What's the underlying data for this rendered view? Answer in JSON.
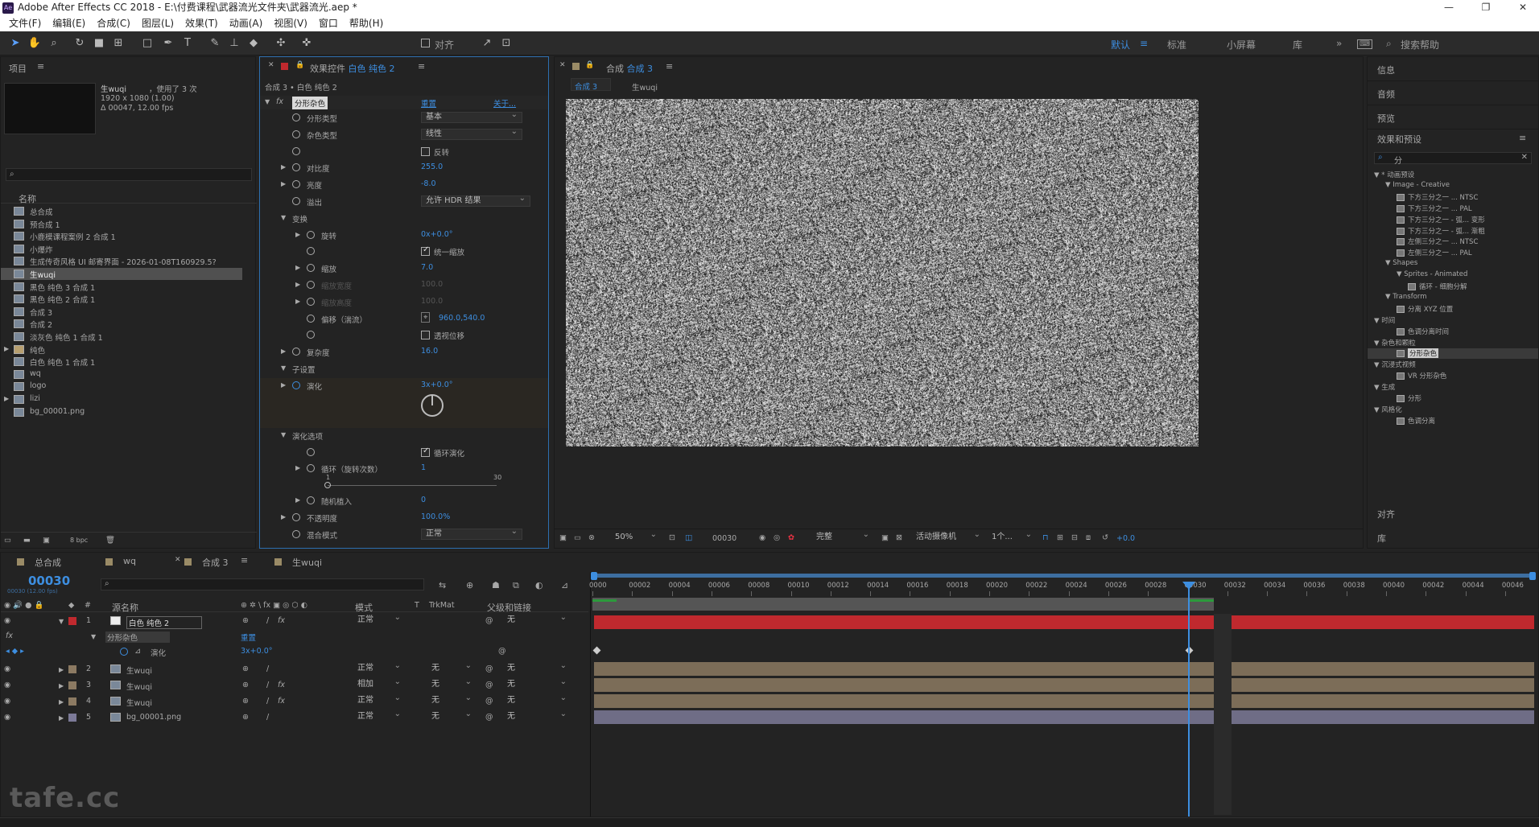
{
  "app": {
    "title": "Adobe After Effects CC 2018 - E:\\付费课程\\武器流光文件夹\\武器流光.aep *",
    "logo": "Ae"
  },
  "menu": [
    "文件(F)",
    "编辑(E)",
    "合成(C)",
    "图层(L)",
    "效果(T)",
    "动画(A)",
    "视图(V)",
    "窗口",
    "帮助(H)"
  ],
  "toolbar": {
    "align_label": "对齐",
    "workspaces": [
      "默认",
      "标准",
      "小屏幕",
      "库"
    ],
    "search_placeholder": "搜索帮助"
  },
  "project": {
    "title": "项目",
    "item_name": "生wuqi",
    "item_info": "，使用了 3 次",
    "item_size": "1920 x 1080 (1.00)",
    "item_dur": "Δ 00047, 12.00 fps",
    "col_name": "名称",
    "bpc": "8 bpc",
    "items": [
      "总合成",
      "预合成 1",
      "小鹿模课程案例 2 合成 1",
      "小爆炸",
      "生成传奇风格 UI 邮寄界面 - 2026-01-08T160929.5?",
      "生wuqi",
      "黑色 纯色 3 合成 1",
      "黑色 纯色 2 合成 1",
      "合成 3",
      "合成 2",
      "淡灰色 纯色 1 合成 1",
      "纯色",
      "白色 纯色 1 合成 1",
      "wq",
      "logo",
      "lizi",
      "bg_00001.png"
    ]
  },
  "effects": {
    "title": "效果控件",
    "layer": "白色 纯色 2",
    "breadcrumb": "合成 3 • 白色 纯色 2",
    "effect_name": "分形杂色",
    "reset": "重置",
    "about": "关于...",
    "props": [
      {
        "label": "分形类型",
        "value": "基本",
        "kind": "dd"
      },
      {
        "label": "杂色类型",
        "value": "线性",
        "kind": "dd"
      },
      {
        "label": "",
        "value": "反转",
        "kind": "cb"
      },
      {
        "label": "对比度",
        "value": "255.0",
        "kind": "num"
      },
      {
        "label": "亮度",
        "value": "-8.0",
        "kind": "num"
      },
      {
        "label": "溢出",
        "value": "允许 HDR 结果",
        "kind": "dd"
      },
      {
        "label": "变换",
        "value": "",
        "kind": "group"
      },
      {
        "label": "旋转",
        "value": "0x+0.0°",
        "kind": "num"
      },
      {
        "label": "",
        "value": "统一缩放",
        "kind": "cbon"
      },
      {
        "label": "缩放",
        "value": "7.0",
        "kind": "num"
      },
      {
        "label": "缩放宽度",
        "value": "100.0",
        "kind": "dim"
      },
      {
        "label": "缩放高度",
        "value": "100.0",
        "kind": "dim"
      },
      {
        "label": "偏移（湍流）",
        "value": "960.0,540.0",
        "kind": "pt"
      },
      {
        "label": "",
        "value": "透视位移",
        "kind": "cb"
      },
      {
        "label": "复杂度",
        "value": "16.0",
        "kind": "num"
      },
      {
        "label": "子设置",
        "value": "",
        "kind": "group"
      },
      {
        "label": "演化",
        "value": "3x+0.0°",
        "kind": "num"
      },
      {
        "label": "演化选项",
        "value": "",
        "kind": "group"
      },
      {
        "label": "",
        "value": "循环演化",
        "kind": "cbon"
      },
      {
        "label": "循环（旋转次数）",
        "value": "1",
        "kind": "num"
      },
      {
        "label": "随机植入",
        "value": "0",
        "kind": "num"
      },
      {
        "label": "不透明度",
        "value": "100.0%",
        "kind": "num"
      },
      {
        "label": "混合模式",
        "value": "正常",
        "kind": "dd"
      }
    ],
    "slider_min": "1",
    "slider_max": "30"
  },
  "comp": {
    "title": "合成",
    "name": "合成 3",
    "tabs": [
      "合成 3",
      "生wuqi"
    ],
    "zoom": "50%",
    "time": "00030",
    "quality": "完整",
    "camera": "活动摄像机",
    "views": "1个...",
    "exposure": "+0.0"
  },
  "right": {
    "panels": [
      "信息",
      "音频",
      "预览"
    ],
    "fx_title": "效果和预设",
    "search": "分",
    "tree": [
      {
        "t": "▼ * 动画预设",
        "d": 0
      },
      {
        "t": "▼ Image - Creative",
        "d": 1
      },
      {
        "t": "下方三分之一 ... NTSC",
        "d": 2
      },
      {
        "t": "下方三分之一 ... PAL",
        "d": 2
      },
      {
        "t": "下方三分之一 - 弧... 变形",
        "d": 2
      },
      {
        "t": "下方三分之一 - 弧... 渐粗",
        "d": 2
      },
      {
        "t": "左侧三分之一 ... NTSC",
        "d": 2
      },
      {
        "t": "左侧三分之一 ... PAL",
        "d": 2
      },
      {
        "t": "▼ Shapes",
        "d": 1
      },
      {
        "t": "▼ Sprites - Animated",
        "d": 2
      },
      {
        "t": "循环 - 细胞分解",
        "d": 3
      },
      {
        "t": "▼ Transform",
        "d": 1
      },
      {
        "t": "分离 XYZ 位置",
        "d": 2
      },
      {
        "t": "▼ 时间",
        "d": 0
      },
      {
        "t": "色调分离时间",
        "d": 2
      },
      {
        "t": "▼ 杂色和颗粒",
        "d": 0
      },
      {
        "t": "分形杂色",
        "d": 2
      },
      {
        "t": "▼ 沉浸式视频",
        "d": 0
      },
      {
        "t": "VR 分形杂色",
        "d": 2
      },
      {
        "t": "▼ 生成",
        "d": 0
      },
      {
        "t": "分形",
        "d": 2
      },
      {
        "t": "▼ 风格化",
        "d": 0
      },
      {
        "t": "色调分离",
        "d": 2
      }
    ],
    "align": "对齐",
    "lib": "库"
  },
  "timeline": {
    "tabs": [
      "总合成",
      "wq",
      "合成 3",
      "生wuqi"
    ],
    "time": "00030",
    "fps": "00030 (12.00 fps)",
    "cols": {
      "source": "源名称",
      "mode": "模式",
      "t": "T",
      "trkmat": "TrkMat",
      "parent": "父级和链接"
    },
    "ruler": [
      "0000",
      "00002",
      "00004",
      "00006",
      "00008",
      "00010",
      "00012",
      "00014",
      "00016",
      "00018",
      "00020",
      "00022",
      "00024",
      "00026",
      "00028",
      "00030",
      "00032",
      "00034",
      "00036",
      "00038",
      "00040",
      "00042",
      "00044",
      "00046"
    ],
    "layers": [
      {
        "n": "1",
        "name": "白色 纯色 2",
        "mode": "正常",
        "trk": "",
        "parent": "无",
        "color": "#c0292e",
        "fx": true
      },
      {
        "n": "2",
        "name": "生wuqi",
        "mode": "正常",
        "trk": "无",
        "parent": "无",
        "color": "#8c7a62",
        "fx": false
      },
      {
        "n": "3",
        "name": "生wuqi",
        "mode": "相加",
        "trk": "无",
        "parent": "无",
        "color": "#8c7a62",
        "fx": true
      },
      {
        "n": "4",
        "name": "生wuqi",
        "mode": "正常",
        "trk": "无",
        "parent": "无",
        "color": "#8c7a62",
        "fx": true
      },
      {
        "n": "5",
        "name": "bg_00001.png",
        "mode": "正常",
        "trk": "无",
        "parent": "无",
        "color": "#7c7a98",
        "fx": false
      }
    ],
    "sub_effect": "分形杂色",
    "sub_reset": "重置",
    "sub_prop": "演化",
    "sub_value": "3x+0.0°"
  },
  "watermark": "tafe.cc"
}
